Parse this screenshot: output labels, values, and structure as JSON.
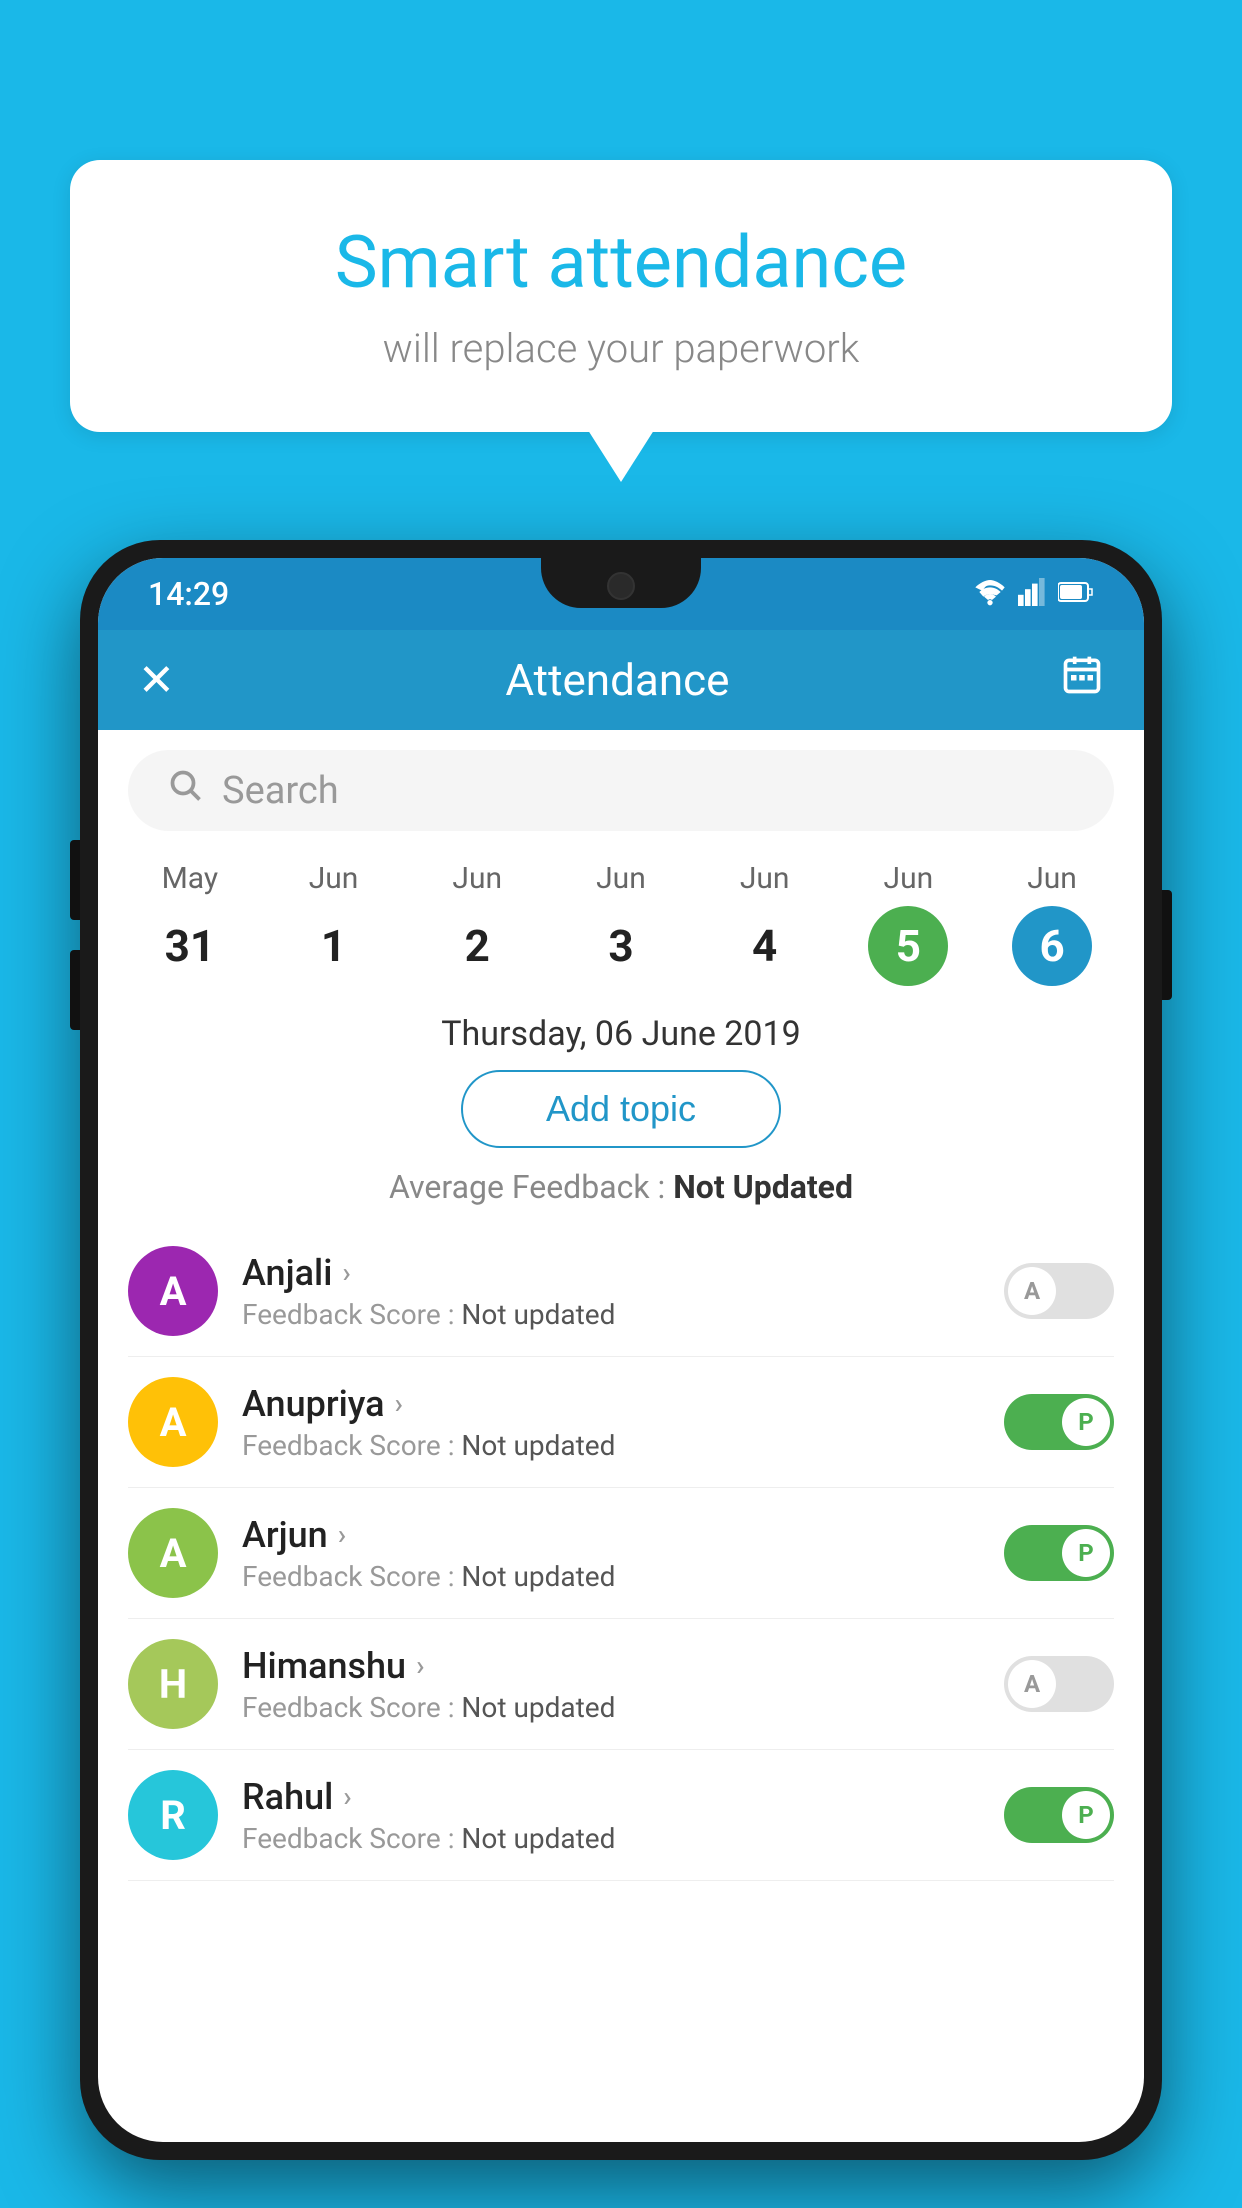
{
  "background_color": "#1ab8e8",
  "speech_bubble": {
    "title": "Smart attendance",
    "subtitle": "will replace your paperwork"
  },
  "status_bar": {
    "time": "14:29",
    "wifi": "▼",
    "signal": "▲",
    "battery": "▮"
  },
  "header": {
    "title": "Attendance",
    "close_label": "✕",
    "calendar_icon": "📅"
  },
  "search": {
    "placeholder": "Search"
  },
  "calendar": {
    "days": [
      {
        "month": "May",
        "date": "31",
        "state": "normal"
      },
      {
        "month": "Jun",
        "date": "1",
        "state": "normal"
      },
      {
        "month": "Jun",
        "date": "2",
        "state": "normal"
      },
      {
        "month": "Jun",
        "date": "3",
        "state": "normal"
      },
      {
        "month": "Jun",
        "date": "4",
        "state": "normal"
      },
      {
        "month": "Jun",
        "date": "5",
        "state": "today"
      },
      {
        "month": "Jun",
        "date": "6",
        "state": "selected"
      }
    ]
  },
  "selected_date": "Thursday, 06 June 2019",
  "add_topic_label": "Add topic",
  "avg_feedback": {
    "label": "Average Feedback : ",
    "value": "Not Updated"
  },
  "students": [
    {
      "name": "Anjali",
      "initial": "A",
      "avatar_color": "#9c27b0",
      "feedback_label": "Feedback Score : ",
      "feedback_value": "Not updated",
      "attendance": "absent"
    },
    {
      "name": "Anupriya",
      "initial": "A",
      "avatar_color": "#ffc107",
      "feedback_label": "Feedback Score : ",
      "feedback_value": "Not updated",
      "attendance": "present"
    },
    {
      "name": "Arjun",
      "initial": "A",
      "avatar_color": "#8bc34a",
      "feedback_label": "Feedback Score : ",
      "feedback_value": "Not updated",
      "attendance": "present"
    },
    {
      "name": "Himanshu",
      "initial": "H",
      "avatar_color": "#a5c85a",
      "feedback_label": "Feedback Score : ",
      "feedback_value": "Not updated",
      "attendance": "absent"
    },
    {
      "name": "Rahul",
      "initial": "R",
      "avatar_color": "#26c6da",
      "feedback_label": "Feedback Score : ",
      "feedback_value": "Not updated",
      "attendance": "present"
    }
  ]
}
